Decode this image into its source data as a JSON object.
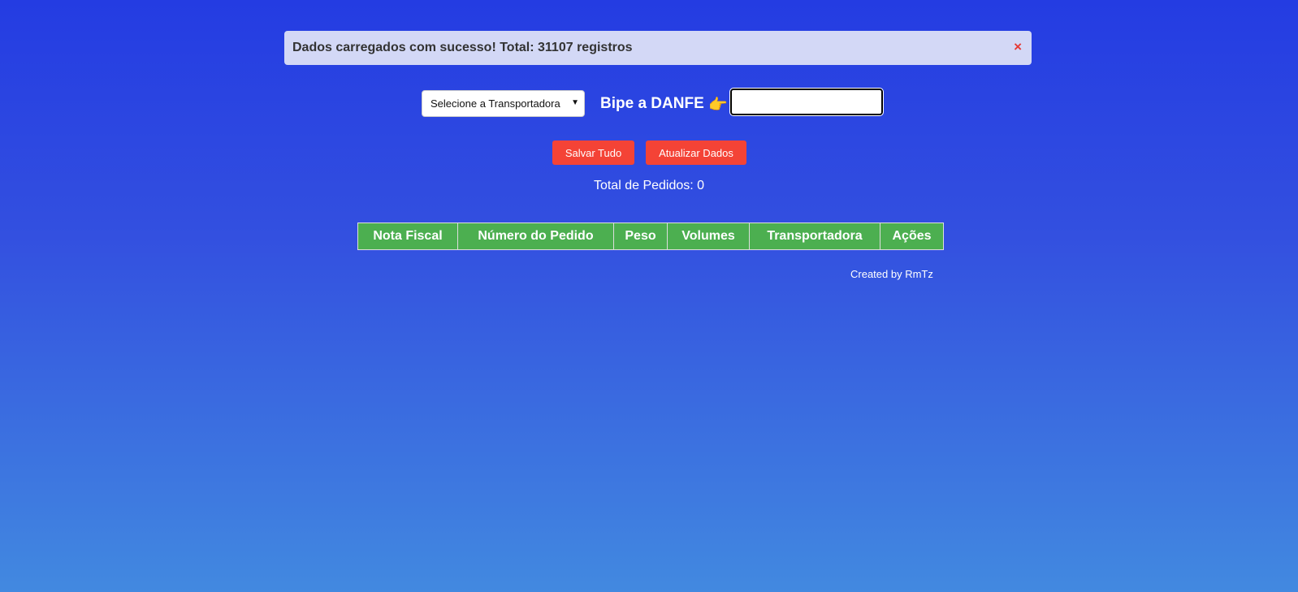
{
  "alert": {
    "message": "Dados carregados com sucesso! Total: 31107 registros",
    "close_icon": "×"
  },
  "toolbar": {
    "carrier_select": {
      "selected": "Selecione a Transportadora"
    },
    "danfe_label": "Bipe a DANFE",
    "danfe_pointer_icon": "👉",
    "danfe_input_value": ""
  },
  "actions": {
    "save_label": "Salvar Tudo",
    "refresh_label": "Atualizar Dados"
  },
  "total_label": "Total de Pedidos: 0",
  "table": {
    "headers": [
      "Nota Fiscal",
      "Número do Pedido",
      "Peso",
      "Volumes",
      "Transportadora",
      "Ações"
    ]
  },
  "footer": "Created by RmTz",
  "colors": {
    "accent_button": "#f44336",
    "table_header": "#4caf50"
  }
}
